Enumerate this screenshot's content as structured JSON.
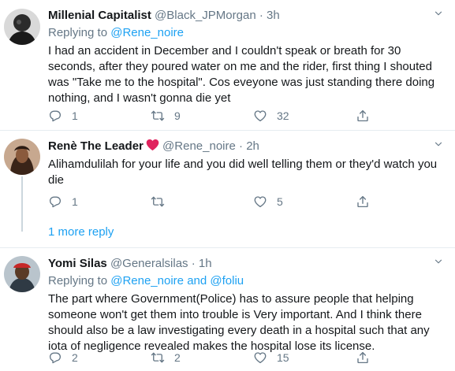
{
  "tweets": [
    {
      "name": "Millenial Capitalist",
      "handle": "@Black_JPMorgan",
      "sep": "·",
      "time": "3h",
      "replying_prefix": "Replying to",
      "replying_to": "@Rene_noire",
      "text": "I had an accident in December and I couldn't speak or breath for 30 seconds, after they poured water on me and the rider, first thing I shouted was \"Take me to the hospital\". Cos eveyone was just standing there doing nothing, and I wasn't gonna die yet",
      "replies": "1",
      "retweets": "9",
      "likes": "32"
    },
    {
      "name": "Renè The Leader",
      "handle": "@Rene_noire",
      "sep": "·",
      "time": "2h",
      "text": "Alihamdulilah for your life and you did well telling them or they'd watch you die",
      "replies": "1",
      "retweets": "",
      "likes": "5"
    },
    {
      "name": "Yomi Silas",
      "handle": "@Generalsilas",
      "sep": "·",
      "time": "1h",
      "replying_prefix": "Replying to",
      "replying_to": "@Rene_noire",
      "replying_and": "and",
      "replying_to2": "@foliu",
      "text": "The part where Government(Police) has to assure people that helping someone won't get them into trouble is Very important. And I think there should also be a law investigating every death in a hospital such that any iota of negligence revealed makes the hospital lose its license.",
      "replies": "2",
      "retweets": "2",
      "likes": "15"
    }
  ],
  "more_replies": "1 more reply",
  "colors": {
    "accent": "#1da1f2",
    "muted": "#657786",
    "heart": "#e0245e",
    "divider": "#e6ecf0"
  },
  "icons": [
    "reply-icon",
    "retweet-icon",
    "like-icon",
    "share-icon",
    "caret-down-icon",
    "red-heart-emoji"
  ]
}
